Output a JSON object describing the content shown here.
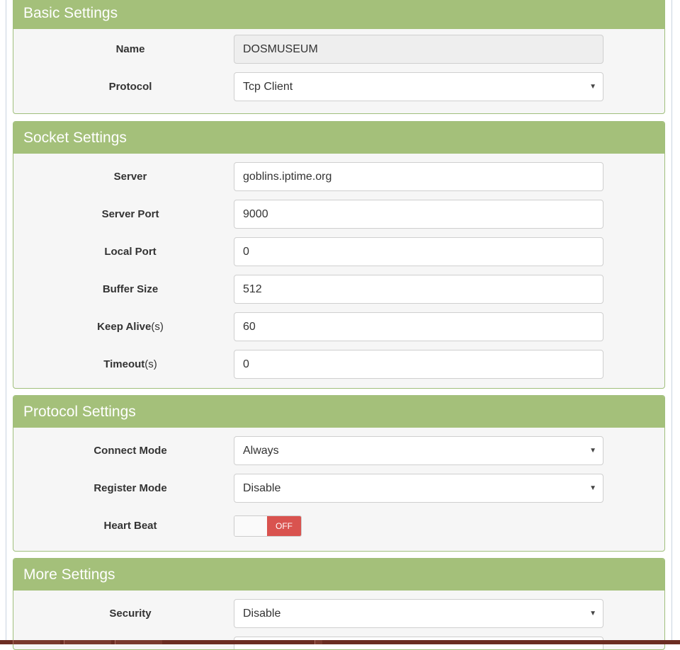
{
  "basic": {
    "title": "Basic Settings",
    "name_label": "Name",
    "name_value": "DOSMUSEUM",
    "protocol_label": "Protocol",
    "protocol_value": "Tcp Client"
  },
  "socket": {
    "title": "Socket Settings",
    "server_label": "Server",
    "server_value": "goblins.iptime.org",
    "server_port_label": "Server Port",
    "server_port_value": "9000",
    "local_port_label": "Local Port",
    "local_port_value": "0",
    "buffer_size_label": "Buffer Size",
    "buffer_size_value": "512",
    "keep_alive_label": "Keep Alive",
    "keep_alive_unit": "(s)",
    "keep_alive_value": "60",
    "timeout_label": "Timeout",
    "timeout_unit": "(s)",
    "timeout_value": "0"
  },
  "protocol": {
    "title": "Protocol Settings",
    "connect_mode_label": "Connect Mode",
    "connect_mode_value": "Always",
    "register_mode_label": "Register Mode",
    "register_mode_value": "Disable",
    "heart_beat_label": "Heart Beat",
    "heart_beat_state": "OFF"
  },
  "more": {
    "title": "More Settings",
    "security_label": "Security",
    "security_value": "Disable"
  },
  "icons": {
    "select_caret": "▼"
  },
  "colors": {
    "panel_header": "#a4c07a",
    "toggle_off": "#d9534f"
  }
}
